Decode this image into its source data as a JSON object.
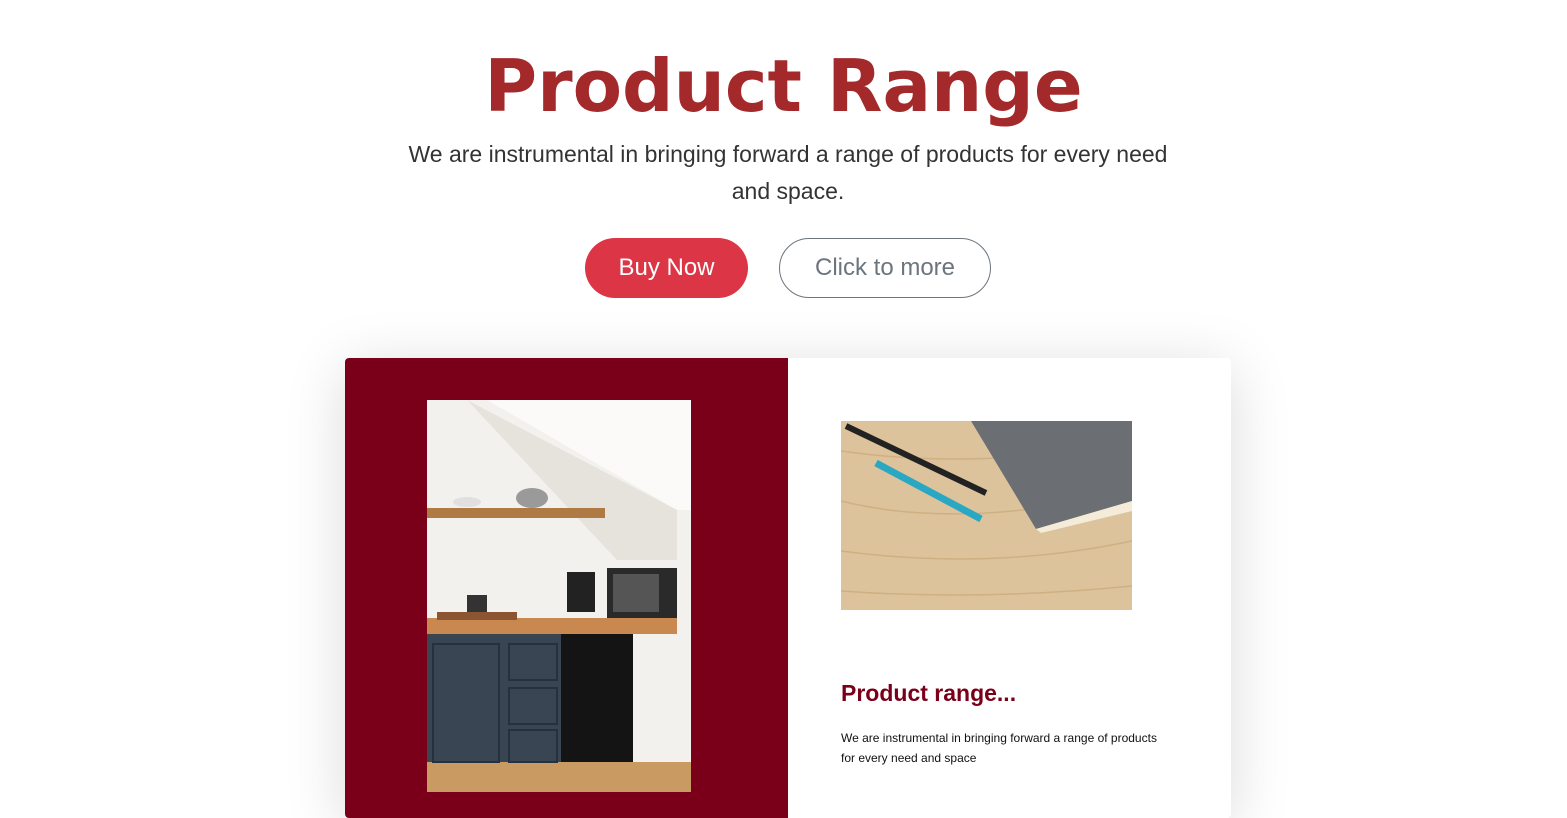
{
  "hero": {
    "title": "Product Range",
    "subtitle": "We are instrumental in bringing forward a range of products for every need and space.",
    "buy_label": "Buy Now",
    "more_label": "Click to more"
  },
  "card": {
    "title": "Product range...",
    "text": "We are instrumental in bringing forward a range of products for every need and space"
  },
  "colors": {
    "title": "#a4292b",
    "buy": "#dc3545",
    "panel": "#7a0019"
  }
}
